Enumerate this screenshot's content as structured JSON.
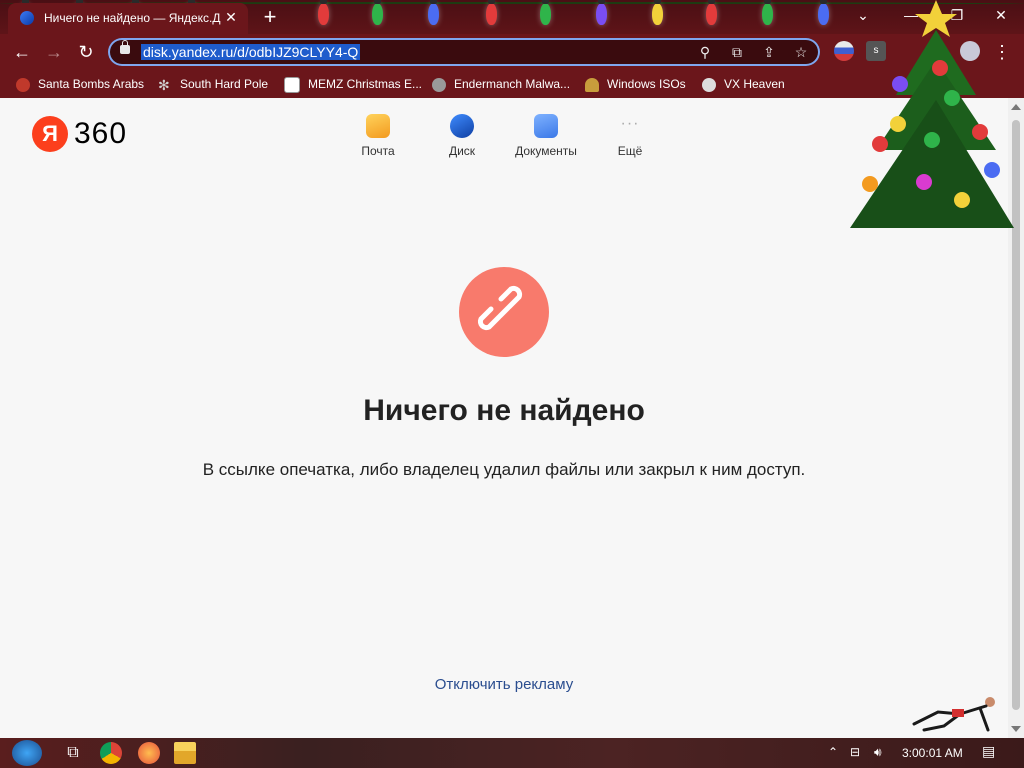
{
  "browser": {
    "tab_title": "Ничего не найдено — Яндекс.Д",
    "url": "disk.yandex.ru/d/odbIJZ9CLYY4-Q",
    "bookmarks": [
      {
        "label": "Santa Bombs Arabs",
        "icon": "santa-icon",
        "color": "#c0392b"
      },
      {
        "label": "South Hard Pole",
        "icon": "snowflake-icon",
        "color": "#d0d0d0"
      },
      {
        "label": "MEMZ Christmas E...",
        "icon": "memz-icon",
        "color": "#ffffff"
      },
      {
        "label": "Endermanch Malwa...",
        "icon": "raccoon-icon",
        "color": "#9a9a9a"
      },
      {
        "label": "Windows ISOs",
        "icon": "figure-icon",
        "color": "#c89d3c"
      },
      {
        "label": "VX Heaven",
        "icon": "vx-icon",
        "color": "#dddddd"
      }
    ]
  },
  "header": {
    "logo_letter": "Я",
    "logo_number": "360",
    "services": [
      {
        "label": "Почта",
        "icon": "mail-icon",
        "color": "#f7b733"
      },
      {
        "label": "Диск",
        "icon": "disk-icon",
        "color": "#1e67d6"
      },
      {
        "label": "Документы",
        "icon": "documents-icon",
        "color": "#4a8cf7"
      },
      {
        "label": "Ещё",
        "icon": "more-icon",
        "color": "#b0b0b0"
      }
    ]
  },
  "main": {
    "heading": "Ничего не найдено",
    "description": "В ссылке опечатка, либо владелец удалил файлы или закрыл к ним доступ.",
    "ad_link": "Отключить рекламу"
  },
  "taskbar": {
    "clock": "3:00:01 AM"
  },
  "colors": {
    "chrome": "#6b161b",
    "error_circle": "#f87a6c",
    "link": "#2a4d8f"
  }
}
